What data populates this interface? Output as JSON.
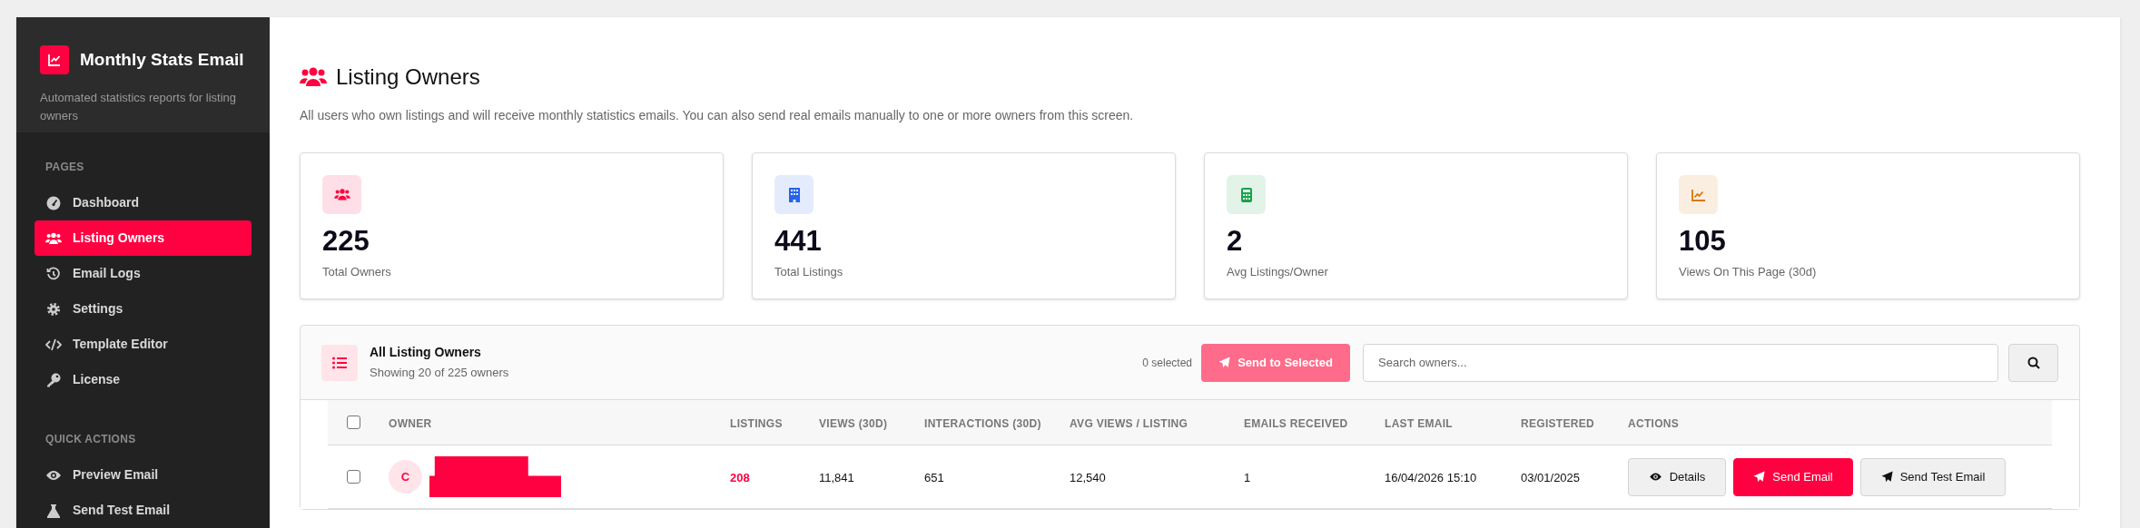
{
  "sidebar": {
    "brand": {
      "title": "Monthly Stats Email",
      "subtitle": "Automated statistics reports for listing owners"
    },
    "sections": [
      {
        "title": "PAGES",
        "items": [
          {
            "label": "Dashboard",
            "selected": false
          },
          {
            "label": "Listing Owners",
            "selected": true
          },
          {
            "label": "Email Logs",
            "selected": false
          },
          {
            "label": "Settings",
            "selected": false
          },
          {
            "label": "Template Editor",
            "selected": false
          },
          {
            "label": "License",
            "selected": false
          }
        ]
      },
      {
        "title": "QUICK ACTIONS",
        "items": [
          {
            "label": "Preview Email",
            "selected": false
          },
          {
            "label": "Send Test Email",
            "selected": false
          }
        ]
      }
    ]
  },
  "page": {
    "title": "Listing Owners",
    "description": "All users who own listings and will receive monthly statistics emails. You can also send real emails manually to one or more owners from this screen."
  },
  "stats": [
    {
      "value": "225",
      "label": "Total Owners",
      "color": "#ff0040"
    },
    {
      "value": "441",
      "label": "Total Listings",
      "color": "#2563eb"
    },
    {
      "value": "2",
      "label": "Avg Listings/Owner",
      "color": "#16a34a"
    },
    {
      "value": "105",
      "label": "Views On This Page (30d)",
      "color": "#d97706"
    }
  ],
  "owners_panel": {
    "title": "All Listing Owners",
    "subtitle": "Showing 20 of 225 owners",
    "selected_count": "0 selected",
    "send_button": {
      "label": "Send to Selected",
      "disabled": true
    },
    "search": {
      "placeholder": "Search owners..."
    },
    "select_all_checked": false,
    "columns": [
      "OWNER",
      "LISTINGS",
      "VIEWS (30D)",
      "INTERACTIONS (30D)",
      "AVG VIEWS / LISTING",
      "EMAILS RECEIVED",
      "LAST EMAIL",
      "REGISTERED",
      "ACTIONS"
    ],
    "rows": [
      {
        "checked": false,
        "initial": "C",
        "listings": "208",
        "views": "11,841",
        "interactions": "651",
        "avg_views": "12,540",
        "emails_received": "1",
        "last_email": "16/04/2026 15:10",
        "registered": "03/01/2025",
        "actions": [
          "Details",
          "Send Email",
          "Send Test Email"
        ]
      }
    ]
  }
}
